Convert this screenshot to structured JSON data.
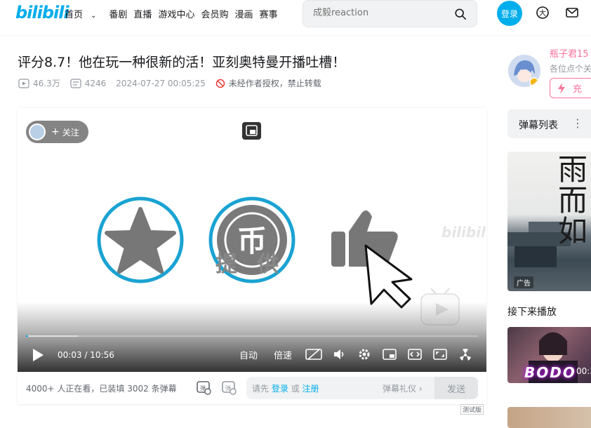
{
  "header": {
    "logo": "bilibili",
    "nav": [
      "首页",
      "番剧",
      "直播",
      "游戏中心",
      "会员购",
      "漫画",
      "赛事"
    ],
    "search_placeholder": "成毅reaction",
    "login_label": "登录"
  },
  "video": {
    "title": "评分8.7！他在玩一种很新的活！亚刻奥特曼开播吐槽！",
    "views": "46.3万",
    "danmaku_count": "4246",
    "pub_time": "2024-07-27 00:05:25",
    "copyright_notice": "未经作者授权，禁止转载"
  },
  "player": {
    "follow_label": "关注",
    "provide_text": "提供",
    "watermark": "bilibili",
    "current_time": "00:03",
    "duration": "10:56",
    "time_separator": "/",
    "progress": 0.005,
    "controls": {
      "auto": "自动",
      "speed": "倍速"
    }
  },
  "danmaku_bar": {
    "watching": "4000+ 人正在看，已装填 3002 条弹幕",
    "prompt_prefix": "请先",
    "login_link": "登录",
    "or": "或",
    "register_link": "注册",
    "etiquette": "弹幕礼仪",
    "send": "发送",
    "beta": "测试版"
  },
  "uploader": {
    "name": "瓶子君15",
    "desc": "各位点个关",
    "charge_label": "充"
  },
  "sidebar": {
    "danmaku_list": "弹幕列表",
    "ad_text": "雨而如",
    "ad_tag": "广告",
    "next_label": "接下来播放",
    "next_thumb_text": "BODO",
    "next_duration": "00:3"
  },
  "colors": {
    "brand": "#00aeec",
    "pink": "#fb7299"
  }
}
